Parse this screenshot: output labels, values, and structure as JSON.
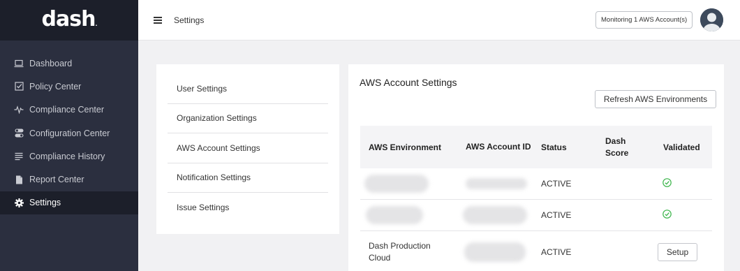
{
  "logo": {
    "text": "dash",
    "dot": "."
  },
  "sidebar": {
    "items": [
      {
        "label": "Dashboard",
        "icon": "laptop-icon"
      },
      {
        "label": "Policy Center",
        "icon": "checkbox-icon"
      },
      {
        "label": "Compliance Center",
        "icon": "pulse-icon"
      },
      {
        "label": "Configuration Center",
        "icon": "toggle-icon"
      },
      {
        "label": "Compliance History",
        "icon": "list-icon"
      },
      {
        "label": "Report Center",
        "icon": "document-icon"
      },
      {
        "label": "Settings",
        "icon": "gear-icon",
        "active": true
      }
    ]
  },
  "header": {
    "title": "Settings",
    "monitor_label": "Monitoring 1 AWS Account(s)"
  },
  "settings_menu": {
    "items": [
      "User Settings",
      "Organization Settings",
      "AWS Account Settings",
      "Notification Settings",
      "Issue Settings"
    ]
  },
  "aws": {
    "title": "AWS Account Settings",
    "refresh_label": "Refresh AWS Environments",
    "columns": [
      "AWS Environment",
      "AWS Account ID",
      "Status",
      "Dash Score",
      "Validated"
    ],
    "rows": [
      {
        "environment": "",
        "account_id": "",
        "status": "ACTIVE",
        "score": "",
        "validated": true
      },
      {
        "environment": "",
        "account_id": "",
        "status": "ACTIVE",
        "score": "",
        "validated": true
      },
      {
        "environment": "Dash Production Cloud",
        "account_id": "",
        "status": "ACTIVE",
        "score": "",
        "validated": false,
        "action": "Setup"
      }
    ]
  },
  "colors": {
    "sidebar_bg": "#2b2f3f",
    "sidebar_active": "#1c1f2a",
    "check_green": "#3bb54a"
  }
}
